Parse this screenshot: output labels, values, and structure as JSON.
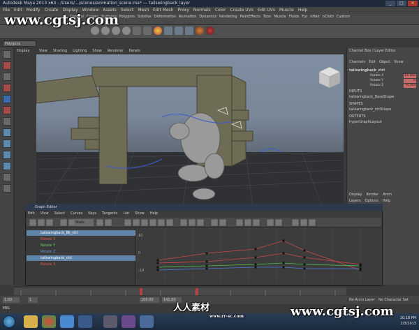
{
  "window": {
    "title": "Autodesk Maya 2013 x64 - /Users/.../scenes/animation_scene.ma* --- tailswingback_layer"
  },
  "menubar": [
    "File",
    "Edit",
    "Modify",
    "Create",
    "Display",
    "Window",
    "Assets",
    "Select",
    "Mesh",
    "Edit Mesh",
    "Proxy",
    "Normals",
    "Color",
    "Create UVs",
    "Edit UVs",
    "Muscle",
    "Help"
  ],
  "shelf_tabs": [
    "General",
    "Curves",
    "Surfaces",
    "Polygons",
    "Subdivs",
    "Deformation",
    "Animation",
    "Dynamics",
    "Rendering",
    "PaintEffects",
    "Toon",
    "Muscle",
    "Fluids",
    "Fur",
    "nHair",
    "nCloth",
    "Custom"
  ],
  "mode_selector": "Polygons",
  "viewport": {
    "panel_menu": [
      "View",
      "Shading",
      "Lighting",
      "Show",
      "Renderer",
      "Panels"
    ],
    "panel_label": "Display"
  },
  "channel_box": {
    "title": "Channel Box / Layer Editor",
    "tabs": [
      "Channels",
      "Edit",
      "Object",
      "Show"
    ],
    "node": "tailswingback_ctrl",
    "attributes": [
      {
        "name": "Rotate X",
        "value": "14.302"
      },
      {
        "name": "Rotate Y",
        "value": "0"
      },
      {
        "name": "Rotate Z",
        "value": "-6.763"
      }
    ],
    "inputs_label": "INPUTS",
    "inputs_node": "tailswingback_BaseShape",
    "shapes_label": "SHAPES",
    "shapes_node": "tailswingback_ctrlShape",
    "outputs_label": "OUTPUTS",
    "outputs_node": "hyperGraphLayout",
    "layer_tabs": [
      "Display",
      "Render",
      "Anim"
    ],
    "layer_menu": [
      "Layers",
      "Options",
      "Help"
    ]
  },
  "graph_editor": {
    "title": "Graph Editor",
    "menu": [
      "Edit",
      "View",
      "Select",
      "Curves",
      "Keys",
      "Tangents",
      "List",
      "Show",
      "Help"
    ],
    "stats_label": "Stats",
    "outliner": [
      {
        "label": "tailswingback_Bk_ctrl",
        "style": "sel"
      },
      {
        "label": "Rotate X",
        "style": "red"
      },
      {
        "label": "Rotate Y",
        "style": "green"
      },
      {
        "label": "Rotate Z",
        "style": "blue"
      },
      {
        "label": "tailswingback_ctrl",
        "style": "sel"
      },
      {
        "label": "Rotate X",
        "style": "red"
      }
    ],
    "y_ticks": [
      "10",
      "0",
      "-10"
    ]
  },
  "time_slider": {
    "start": "1.00",
    "end": "100.00",
    "current": "1",
    "range_start": "1.00",
    "range_end": "141.00",
    "anim_layer": "No Anim Layer",
    "char_set": "No Character Set"
  },
  "command_line": "MEL",
  "taskbar": {
    "time": "10:18 PM",
    "date": "2/3/2013"
  },
  "watermarks": {
    "top": "www.cgtsj.com",
    "bottom": "www.cgtsj.com",
    "logo": "人人素材",
    "logo_sub": "www.rr-sc.com"
  },
  "colors": {
    "accent": "#5f83a8",
    "curve_red": "#d04a4a",
    "curve_green": "#4ac04a",
    "curve_blue": "#4a7ad0",
    "attr_highlight": "#c86a6a"
  }
}
